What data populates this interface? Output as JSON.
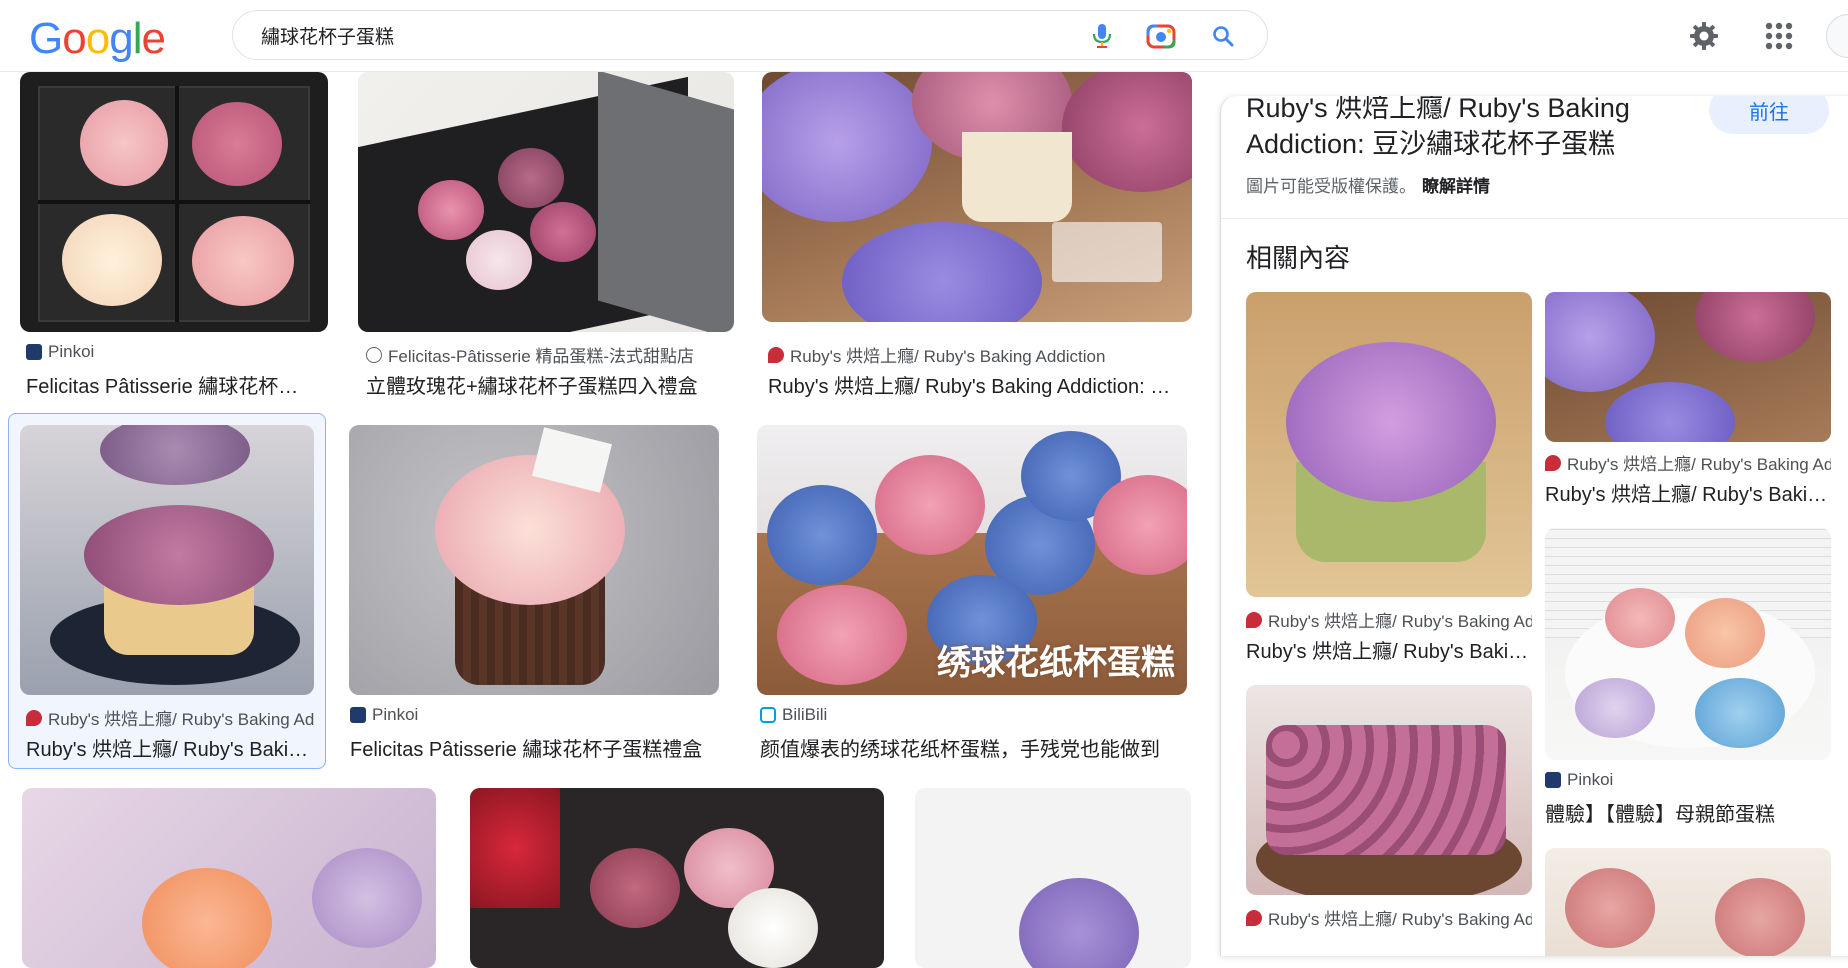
{
  "search": {
    "query": "繡球花杯子蛋糕"
  },
  "logo": [
    "G",
    "o",
    "o",
    "g",
    "l",
    "e"
  ],
  "colors": {
    "blue": "#4285F4",
    "red": "#EA4335",
    "yellow": "#FBBC05",
    "green": "#34A853",
    "link": "#1a73e8"
  },
  "grid": [
    {
      "source": "Pinkoi",
      "title": "Felicitas Pâtisserie 繡球花杯子蛋糕",
      "icon": "pinkoi-icon"
    },
    {
      "source": "Felicitas-Pâtisserie 精品蛋糕-法式甜點店",
      "title": "立體玫瑰花+繡球花杯子蛋糕四入禮盒",
      "icon": "globe-icon"
    },
    {
      "source": "Ruby's 烘焙上癮/ Ruby's Baking Addiction",
      "title": "Ruby's 烘焙上癮/ Ruby's Baking Addiction: 豆沙繡球花杯子蛋糕",
      "icon": "ruby-icon"
    },
    {
      "source": "Ruby's 烘焙上癮/ Ruby's Baking Addiction",
      "title": "Ruby's 烘焙上癮/ Ruby's Baking Addiction",
      "icon": "ruby-icon"
    },
    {
      "source": "Pinkoi",
      "title": "Felicitas Pâtisserie 繡球花杯子蛋糕禮盒",
      "icon": "pinkoi-icon"
    },
    {
      "source": "BiliBili",
      "title": "颜值爆表的绣球花纸杯蛋糕，手残党也能做到",
      "icon": "bilibili-icon",
      "overlay": "绣球花纸杯蛋糕"
    }
  ],
  "panel": {
    "title": "Ruby's 烘焙上癮/ Ruby's Baking Addiction: 豆沙繡球花杯子蛋糕",
    "go": "前往",
    "copyright": "圖片可能受版權保護。",
    "learn_more": "瞭解詳情",
    "related_heading": "相關內容",
    "related": [
      {
        "source": "Ruby's 烘焙上癮/ Ruby's Baking Addiction",
        "title": "Ruby's 烘焙上癮/ Ruby's Baking Addiction",
        "icon": "ruby-icon"
      },
      {
        "source": "Ruby's 烘焙上癮/ Ruby's Baking Addiction",
        "title": "Ruby's 烘焙上癮/ Ruby's Baking Addiction",
        "icon": "ruby-icon"
      },
      {
        "source": "Ruby's 烘焙上癮/ Ruby's Baking Addiction",
        "title": "Ruby's 烘焙上癮/ Ruby's Baking Addiction",
        "icon": "ruby-icon"
      },
      {
        "source": "Pinkoi",
        "title": "體驗】【體驗】母親節蛋糕",
        "icon": "pinkoi-icon"
      }
    ]
  }
}
